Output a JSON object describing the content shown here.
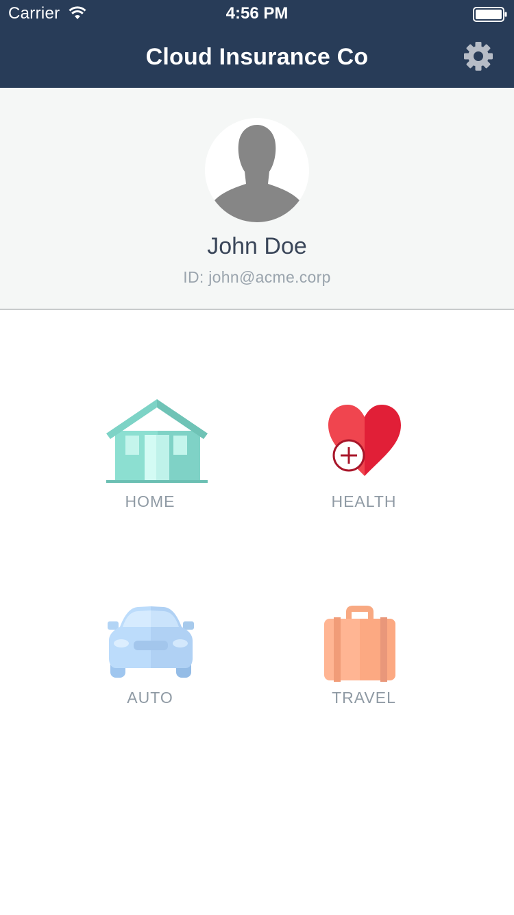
{
  "status_bar": {
    "carrier": "Carrier",
    "time": "4:56 PM",
    "icons": [
      "wifi-icon",
      "battery-icon"
    ]
  },
  "header": {
    "title": "Cloud Insurance Co",
    "background": "#283c58",
    "settings_icon": "gear-icon"
  },
  "profile": {
    "name": "John Doe",
    "id_text": "ID: john@acme.corp",
    "avatar_icon": "user-silhouette-icon"
  },
  "categories": [
    {
      "label": "HOME",
      "icon": "house-icon"
    },
    {
      "label": "HEALTH",
      "icon": "heart-plus-icon"
    },
    {
      "label": "AUTO",
      "icon": "car-icon"
    },
    {
      "label": "TRAVEL",
      "icon": "suitcase-icon"
    }
  ]
}
